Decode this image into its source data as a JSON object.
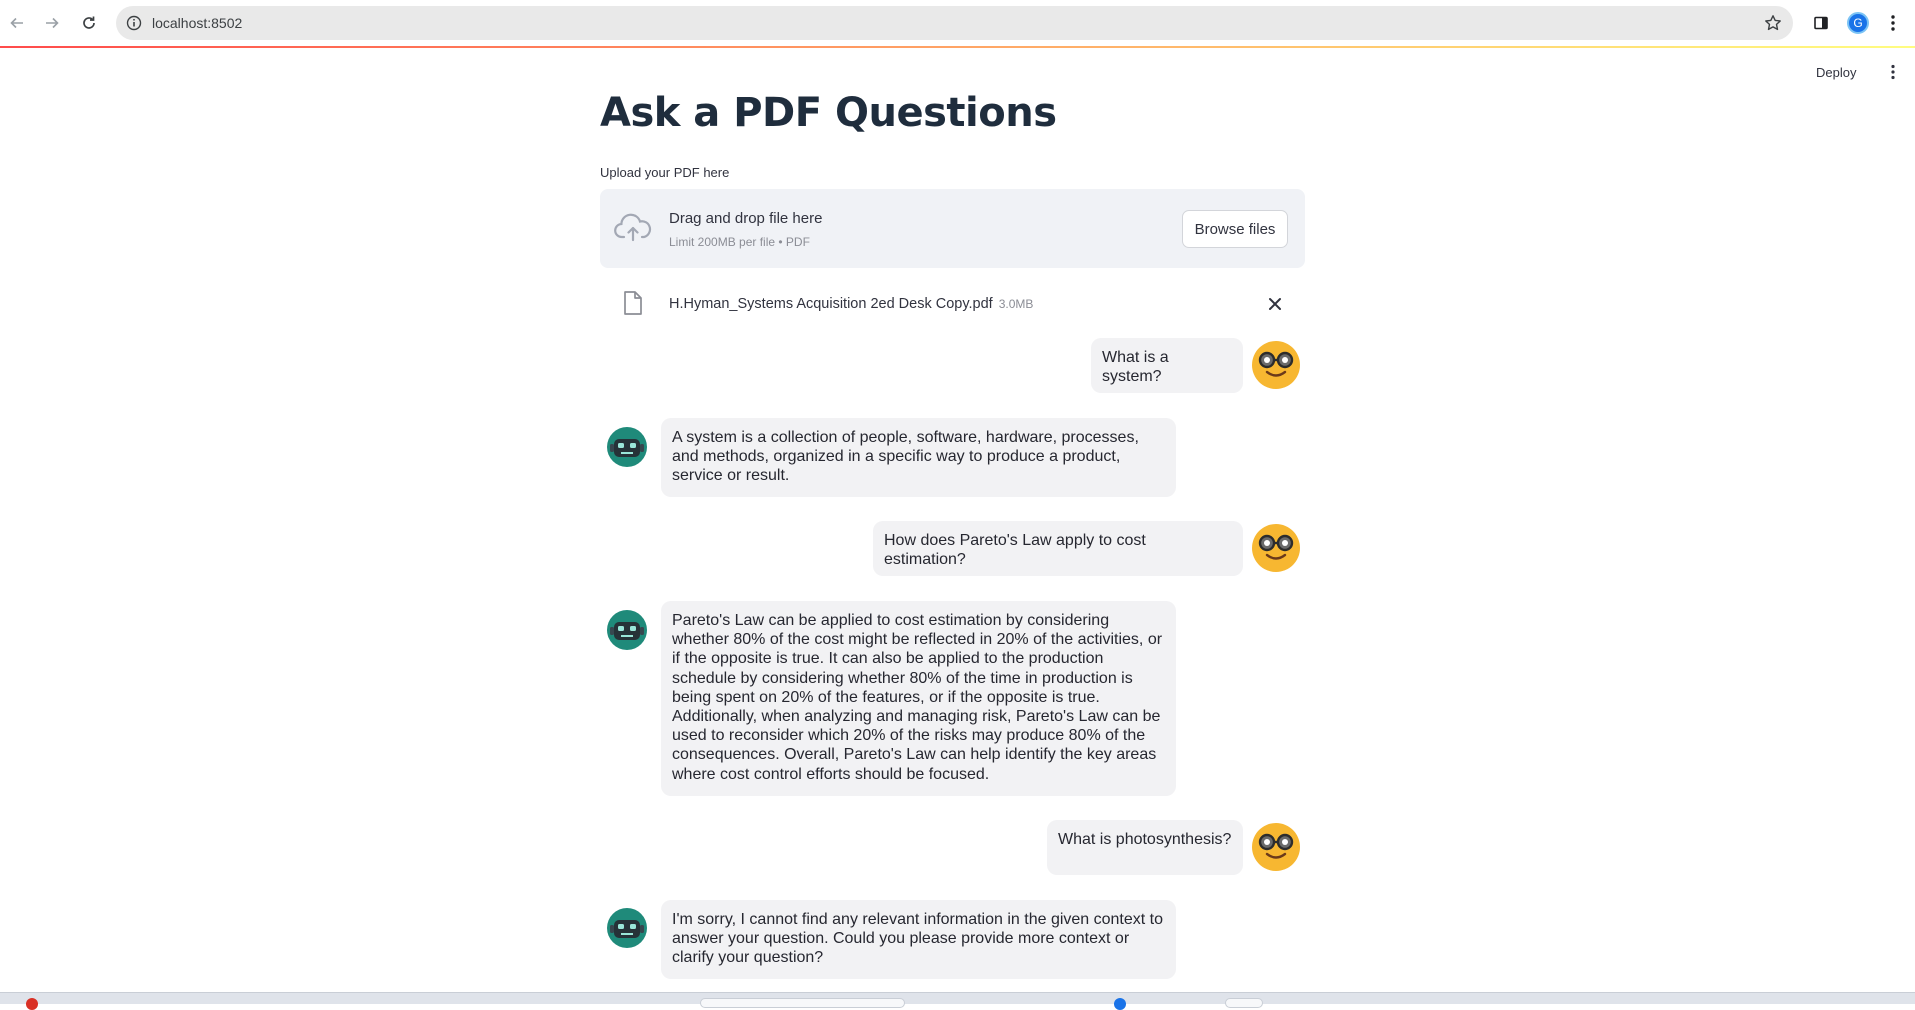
{
  "browser": {
    "url": "localhost:8502",
    "profile_initial": "G"
  },
  "header": {
    "deploy_label": "Deploy"
  },
  "page": {
    "title": "Ask a PDF Questions",
    "upload_label": "Upload your PDF here"
  },
  "uploader": {
    "drop_title": "Drag and drop file here",
    "limit_text": "Limit 200MB per file • PDF",
    "browse_label": "Browse files"
  },
  "file": {
    "name": "H.Hyman_Systems Acquisition 2ed Desk Copy.pdf",
    "size": "3.0MB"
  },
  "chat": [
    {
      "role": "user",
      "text": "What is a system?"
    },
    {
      "role": "assistant",
      "text": "A system is a collection of people, software, hardware, processes, and methods, organized in a specific way to produce a product, service or result."
    },
    {
      "role": "user",
      "text": "How does Pareto's Law apply to cost estimation?"
    },
    {
      "role": "assistant",
      "text": "Pareto's Law can be applied to cost estimation by considering whether 80% of the cost might be reflected in 20% of the activities, or if the opposite is true. It can also be applied to the production schedule by considering whether 80% of the time in production is being spent on 20% of the features, or if the opposite is true. Additionally, when analyzing and managing risk, Pareto's Law can be used to reconsider which 20% of the risks may produce 80% of the consequences. Overall, Pareto's Law can help identify the key areas where cost control efforts should be focused."
    },
    {
      "role": "user",
      "text": "What is photosynthesis?"
    },
    {
      "role": "assistant",
      "text": "I'm sorry, I cannot find any relevant information in the given context to answer your question. Could you please provide more context or clarify your question?"
    }
  ],
  "colors": {
    "title": "#1f2d3d",
    "bubble_bg": "#f2f2f4",
    "dropzone_bg": "#f0f2f6",
    "user_avatar": "#f7b731",
    "bot_avatar": "#1f8a7a",
    "accent_gradient_start": "#ff4b4b",
    "accent_gradient_end": "#fffd80"
  },
  "icons": {
    "back": "arrow-left-icon",
    "forward": "arrow-right-icon",
    "reload": "reload-icon",
    "site_info": "info-icon",
    "bookmark": "star-icon",
    "upload": "cloud-upload-icon",
    "file": "document-icon",
    "remove": "close-icon",
    "user_avatar": "nerd-face-icon",
    "bot_avatar": "robot-icon"
  }
}
